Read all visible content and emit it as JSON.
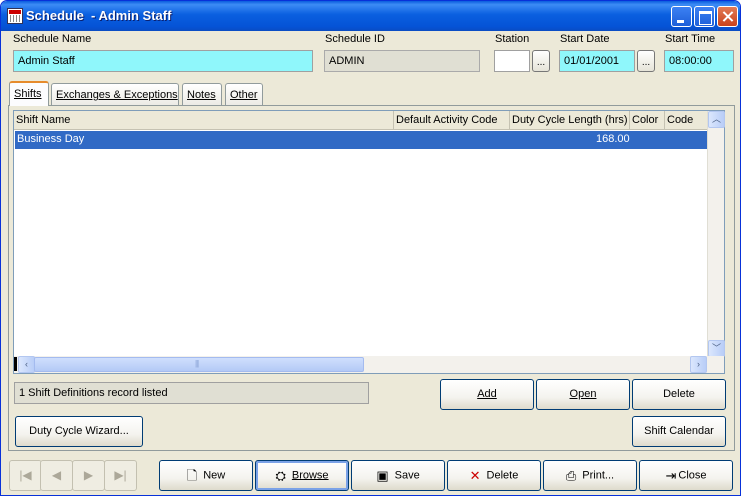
{
  "window": {
    "title": "Schedule  - Admin Staff"
  },
  "header": {
    "schedule_name_label": "Schedule Name",
    "schedule_name_value": "Admin Staff",
    "schedule_id_label": "Schedule ID",
    "schedule_id_value": "ADMIN",
    "station_label": "Station",
    "station_value": "",
    "start_date_label": "Start Date",
    "start_date_value": "01/01/2001",
    "start_time_label": "Start Time",
    "start_time_value": "08:00:00",
    "ellipsis": "..."
  },
  "tabs": [
    {
      "label": "Shifts",
      "active": true
    },
    {
      "label": "Exchanges & Exceptions",
      "active": false
    },
    {
      "label": "Notes",
      "active": false
    },
    {
      "label": "Other",
      "active": false
    }
  ],
  "grid": {
    "columns": [
      "Shift Name",
      "Default Activity Code",
      "Duty Cycle Length (hrs)",
      "Color",
      "Code"
    ],
    "rows": [
      {
        "shift_name": "Business Day",
        "default_activity_code": "",
        "duty_cycle_length": "168.00",
        "color": "",
        "code": "",
        "selected": true
      }
    ]
  },
  "status": {
    "text": "1 Shift Definitions record listed"
  },
  "panel_buttons": {
    "add": "Add",
    "open": "Open",
    "delete": "Delete",
    "duty_cycle_wizard": "Duty Cycle Wizard...",
    "shift_calendar": "Shift Calendar"
  },
  "toolbar": {
    "new": "New",
    "browse": "Browse",
    "save": "Save",
    "delete": "Delete",
    "print": "Print...",
    "close": "Close"
  },
  "nav": {
    "first_icon": "first-record-icon",
    "prev_icon": "previous-record-icon",
    "next_icon": "next-record-icon",
    "last_icon": "last-record-icon"
  },
  "colors": {
    "title_bar": "#0a5fe0",
    "editable_field": "#8ff7fb",
    "selection": "#316ac5",
    "active_tab_accent": "#e68b2c"
  }
}
